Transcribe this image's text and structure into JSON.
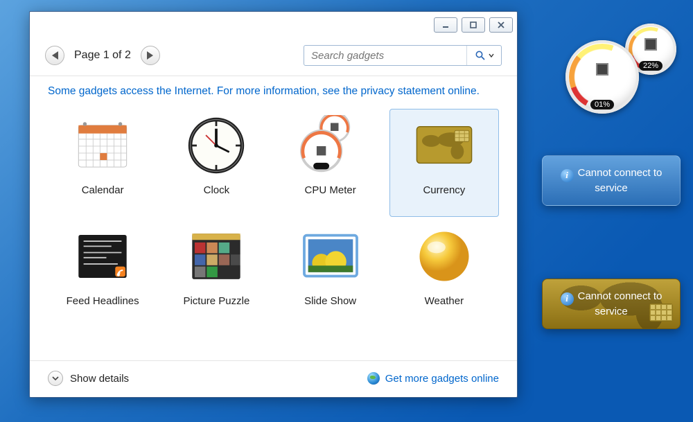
{
  "titlebar": {
    "min": "minimize",
    "max": "maximize",
    "close": "close"
  },
  "pager": {
    "label": "Page 1 of 2"
  },
  "search": {
    "placeholder": "Search gadgets"
  },
  "info_line": "Some gadgets access the Internet.  For more information, see the privacy statement online.",
  "gadgets": [
    {
      "label": "Calendar",
      "icon": "calendar",
      "selected": false
    },
    {
      "label": "Clock",
      "icon": "clock",
      "selected": false
    },
    {
      "label": "CPU Meter",
      "icon": "cpu-meter",
      "selected": false
    },
    {
      "label": "Currency",
      "icon": "currency",
      "selected": true
    },
    {
      "label": "Feed Headlines",
      "icon": "feed-headlines",
      "selected": false
    },
    {
      "label": "Picture Puzzle",
      "icon": "picture-puzzle",
      "selected": false
    },
    {
      "label": "Slide Show",
      "icon": "slide-show",
      "selected": false
    },
    {
      "label": "Weather",
      "icon": "weather",
      "selected": false
    }
  ],
  "footer": {
    "details": "Show details",
    "more_link": "Get more gadgets online"
  },
  "cpu_meter": {
    "cpu_pct": "01%",
    "ram_pct": "22%"
  },
  "desk_weather": {
    "message": "Cannot connect to service"
  },
  "desk_currency": {
    "message": "Cannot connect to service"
  },
  "colors": {
    "link": "#0066cc",
    "selection": "#e8f2fb",
    "selection_border": "#8fbde8"
  }
}
